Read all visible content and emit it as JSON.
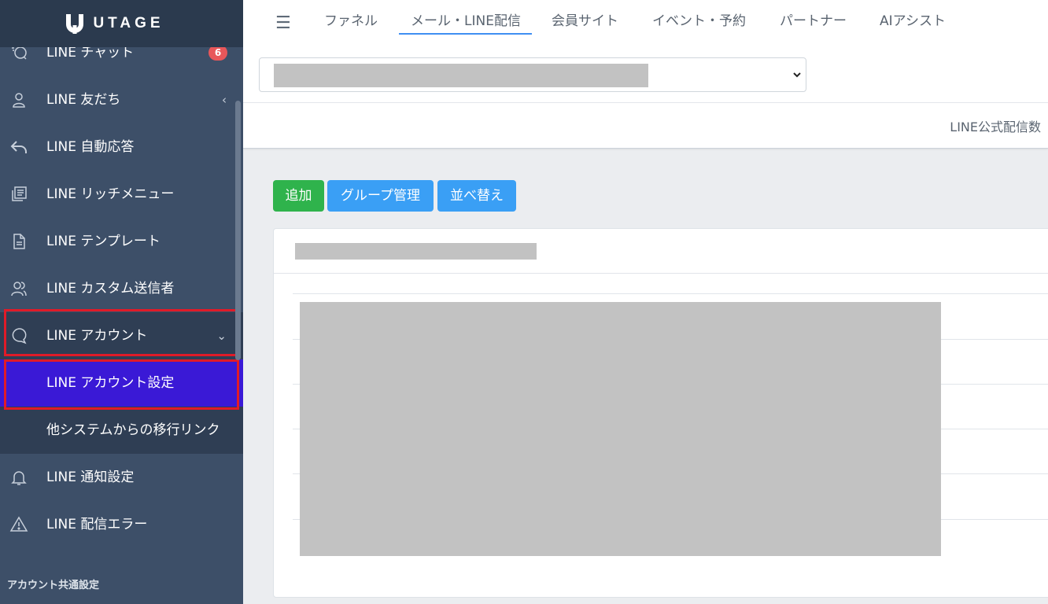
{
  "app": {
    "logo_text": "UTAGE"
  },
  "sidebar": {
    "items": [
      {
        "label": "LINE チャット",
        "icon": "chat-icon",
        "badge": "6"
      },
      {
        "label": "LINE 友だち",
        "icon": "user-icon",
        "arrow": "‹"
      },
      {
        "label": "LINE 自動応答",
        "icon": "reply-icon"
      },
      {
        "label": "LINE リッチメニュー",
        "icon": "copy-icon"
      },
      {
        "label": "LINE テンプレート",
        "icon": "document-icon"
      },
      {
        "label": "LINE カスタム送信者",
        "icon": "users-icon"
      },
      {
        "label": "LINE アカウント",
        "icon": "chat-bubble-icon",
        "arrow": "⌄"
      },
      {
        "label": "LINE 通知設定",
        "icon": "bell-icon"
      },
      {
        "label": "LINE 配信エラー",
        "icon": "warning-icon"
      }
    ],
    "sub_items": [
      {
        "label": "LINE アカウント設定"
      },
      {
        "label": "他システムからの移行リンク"
      }
    ],
    "section_label": "アカウント共通設定"
  },
  "topnav": {
    "menu_icon": "☰",
    "tabs": [
      {
        "label": "ファネル"
      },
      {
        "label": "メール・LINE配信",
        "active": true
      },
      {
        "label": "会員サイト"
      },
      {
        "label": "イベント・予約"
      },
      {
        "label": "パートナー"
      },
      {
        "label": "AIアシスト"
      }
    ]
  },
  "subbar": {
    "text": "LINE公式配信数"
  },
  "toolbar": {
    "add_label": "追加",
    "group_label": "グループ管理",
    "sort_label": "並べ替え"
  },
  "colors": {
    "sidebar_bg": "#3d4f68",
    "logo_bg": "#2b3a4e",
    "active_sub": "#3a19d6",
    "highlight": "#e01b28",
    "btn_green": "#2fb34c",
    "btn_blue": "#3a9ff5",
    "tab_underline": "#3f8ff2",
    "badge": "#e8575a"
  }
}
